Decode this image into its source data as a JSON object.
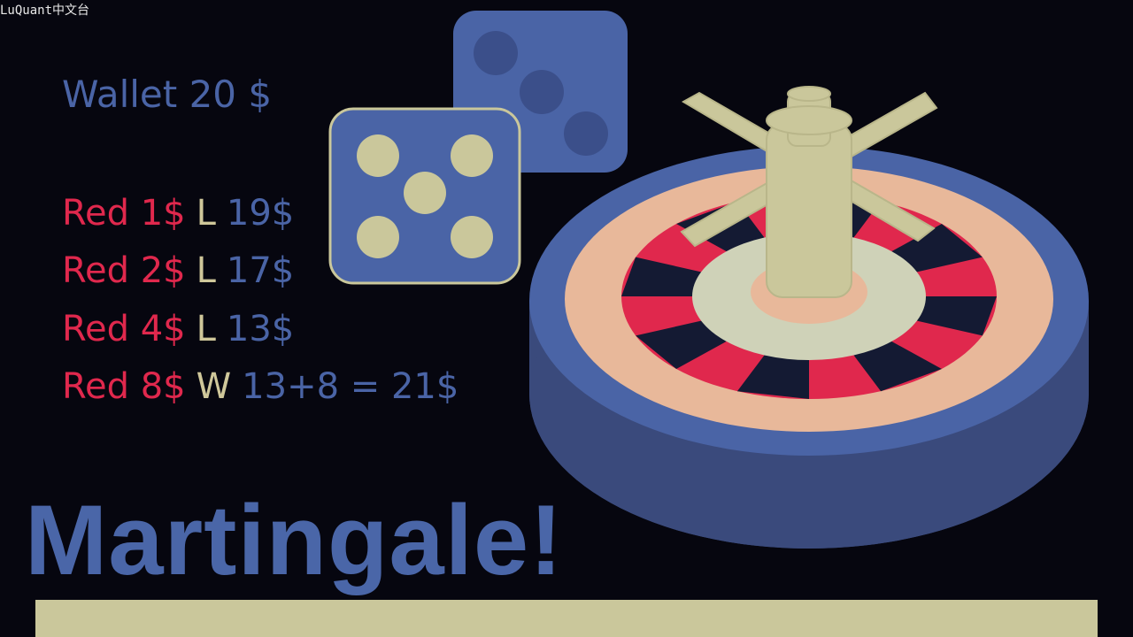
{
  "watermark": "LuQuant中文台",
  "wallet": "Wallet 20 $",
  "bets": [
    {
      "bet": "Red 1$",
      "outcome": "L",
      "balance": "19$"
    },
    {
      "bet": "Red 2$",
      "outcome": "L",
      "balance": "17$"
    },
    {
      "bet": "Red 4$",
      "outcome": "L",
      "balance": "13$"
    },
    {
      "bet": "Red 8$",
      "outcome": "W",
      "balance": "13+8 = 21$"
    }
  ],
  "title": "Martingale!",
  "graphics": {
    "dice": [
      {
        "name": "back-die",
        "pips": 3
      },
      {
        "name": "front-die",
        "pips": 5
      }
    ],
    "roulette_wheel": {
      "pocket_colors": [
        "red",
        "black"
      ]
    }
  },
  "colors": {
    "background": "#06060f",
    "red": "#e0284d",
    "blue": "#4a64a6",
    "cream": "#cac79b",
    "peach": "#e8b89a",
    "wheel_outer": "#3f5592"
  }
}
